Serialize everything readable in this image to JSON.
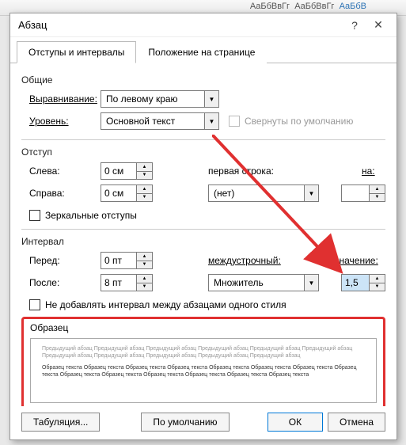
{
  "ribbon": {
    "style1": "АаБбВвГг",
    "style2": "АаБбВвГг",
    "style3": "АаБбВ"
  },
  "dialog": {
    "title": "Абзац",
    "help": "?",
    "close": "✕"
  },
  "tabs": {
    "t1": "Отступы и интервалы",
    "t2": "Положение на странице"
  },
  "general": {
    "group": "Общие",
    "align_label": "Выравнивание:",
    "align_value": "По левому краю",
    "level_label": "Уровень:",
    "level_value": "Основной текст",
    "collapse": "Свернуты по умолчанию"
  },
  "indent": {
    "group": "Отступ",
    "left_label": "Слева:",
    "left_value": "0 см",
    "right_label": "Справа:",
    "right_value": "0 см",
    "firstline_label": "первая строка:",
    "firstline_value": "(нет)",
    "by_label": "на:",
    "by_value": "",
    "mirror": "Зеркальные отступы"
  },
  "spacing": {
    "group": "Интервал",
    "before_label": "Перед:",
    "before_value": "0 пт",
    "after_label": "После:",
    "after_value": "8 пт",
    "line_label": "междустрочный:",
    "line_value": "Множитель",
    "val_label": "значение:",
    "val_value": "1,5",
    "noadd": "Не добавлять интервал между абзацами одного стиля"
  },
  "preview": {
    "group": "Образец",
    "light": "Предыдущий абзац Предыдущий абзац Предыдущий абзац Предыдущий абзац Предыдущий абзац Предыдущий абзац Предыдущий абзац Предыдущий абзац Предыдущий абзац Предыдущий абзац Предыдущий абзац",
    "dark": "Образец текста Образец текста Образец текста Образец текста Образец текста Образец текста Образец текста Образец текста Образец текста Образец текста Образец текста Образец текста Образец текста Образец текста"
  },
  "footer": {
    "tabs": "Табуляция...",
    "defaults": "По умолчанию",
    "ok": "ОК",
    "cancel": "Отмена"
  }
}
